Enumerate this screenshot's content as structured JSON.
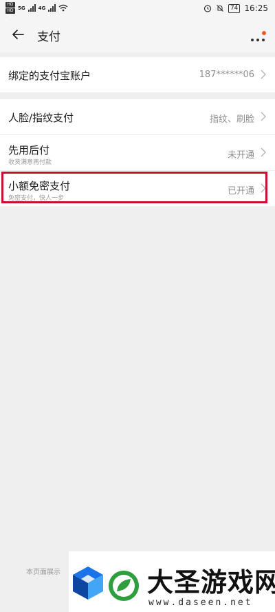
{
  "status_bar": {
    "sim1": "HD 1",
    "sim2": "HD 2",
    "network1": "5G",
    "network2": "4G",
    "battery": "74",
    "time": "16:25"
  },
  "nav": {
    "title": "支付"
  },
  "account": {
    "label": "绑定的支付宝账户",
    "value": "187******06"
  },
  "payment_rows": [
    {
      "title": "人脸/指纹支付",
      "subtitle": "",
      "value": "指纹、刷脸"
    },
    {
      "title": "先用后付",
      "subtitle": "收货满意再付款",
      "value": "未开通"
    },
    {
      "title": "小额免密支付",
      "subtitle": "免密支付，快人一步",
      "value": "已开通"
    }
  ],
  "footer": {
    "text": "本页面展示"
  },
  "watermark": {
    "name": "大圣游戏网",
    "url": "www.daseen.net"
  },
  "colors": {
    "highlight": "#c8102e",
    "notification_dot": "#f05a22"
  }
}
